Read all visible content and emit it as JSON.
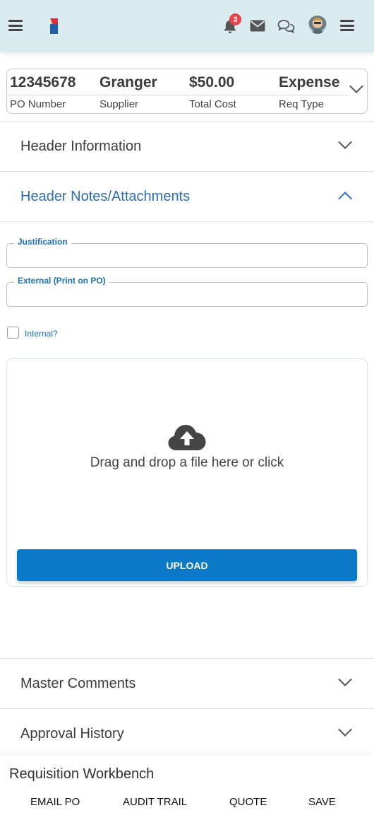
{
  "topbar": {
    "notification_count": "3",
    "icons": [
      "menu-icon",
      "logo",
      "bell-icon",
      "mail-icon",
      "chat-icon",
      "avatar",
      "overflow-menu-icon"
    ]
  },
  "summary": {
    "po_number": {
      "value": "12345678",
      "label": "PO Number"
    },
    "supplier": {
      "value": "Granger",
      "label": "Supplier"
    },
    "total_cost": {
      "value": "$50.00",
      "label": "Total Cost"
    },
    "req_type": {
      "value": "Expense",
      "label": "Req Type"
    }
  },
  "sections": {
    "header_information": "Header Information",
    "header_notes": "Header Notes/Attachments",
    "master_comments": "Master Comments",
    "approval_history": "Approval History"
  },
  "fields": {
    "justification": {
      "label": "Justification",
      "value": ""
    },
    "external": {
      "label": "External (Print on PO)",
      "value": ""
    },
    "internal_label": "Internal?"
  },
  "dropzone": {
    "text": "Drag and drop a file here or click",
    "upload_label": "UPLOAD"
  },
  "bottom": {
    "title": "Requisition Workbench",
    "actions": [
      "EMAIL PO",
      "AUDIT TRAIL",
      "QUOTE",
      "SAVE"
    ]
  },
  "colors": {
    "topbar_bg": "#dbecf1",
    "accent_blue": "#2f6db5",
    "button_blue": "#0b7ac6",
    "badge_red": "#e8434b"
  }
}
